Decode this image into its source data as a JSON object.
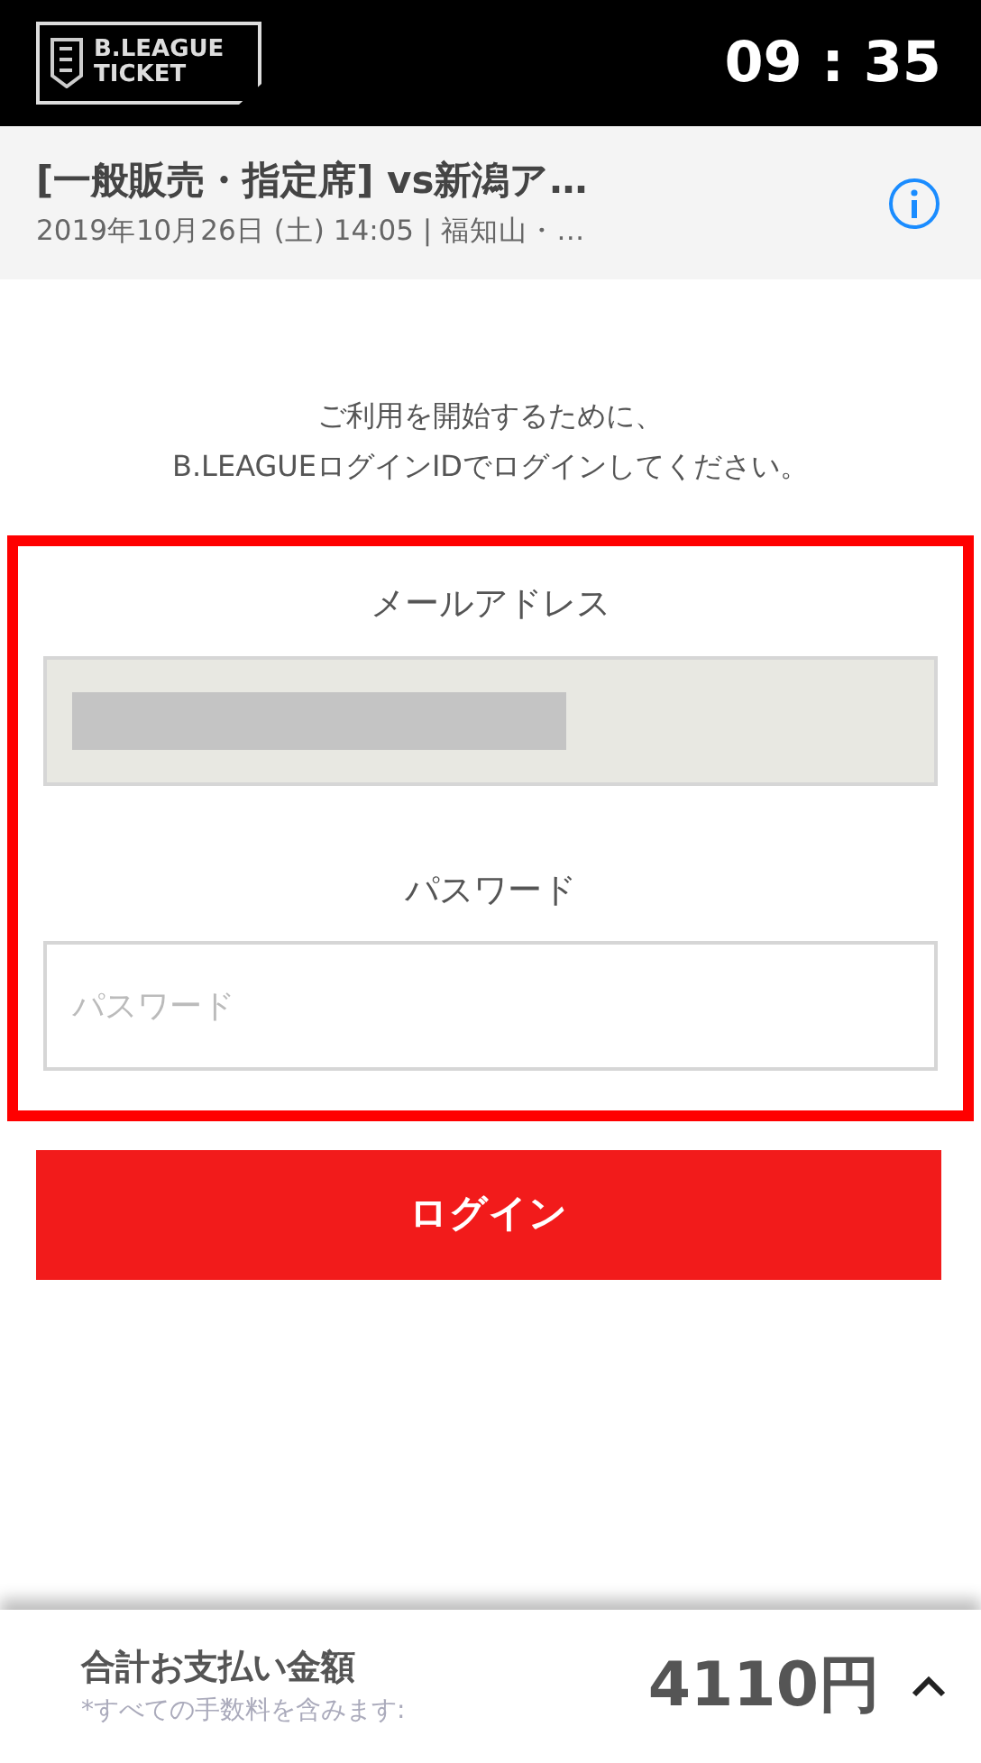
{
  "header": {
    "logo_lines": [
      "B.LEAGUE",
      "TICKET"
    ],
    "time": "09 : 35"
  },
  "event": {
    "title": "[一般販売・指定席] vs新潟ア…",
    "subtitle": "2019年10月26日 (土) 14:05 | 福知山・…"
  },
  "intro": [
    "ご利用を開始するために、",
    "B.LEAGUEログインIDでログインしてください。"
  ],
  "login_form": {
    "highlighted": true,
    "fields": [
      {
        "label": "メールアドレス",
        "kind": "filled"
      },
      {
        "label": "パスワード",
        "kind": "password",
        "placeholder": "パスワード"
      }
    ]
  },
  "login_button": "ログイン",
  "footer": {
    "total_label": "合計お支払い金額",
    "note": "*すべての手数料を含みます:",
    "amount": "4110円",
    "expanded": false
  }
}
